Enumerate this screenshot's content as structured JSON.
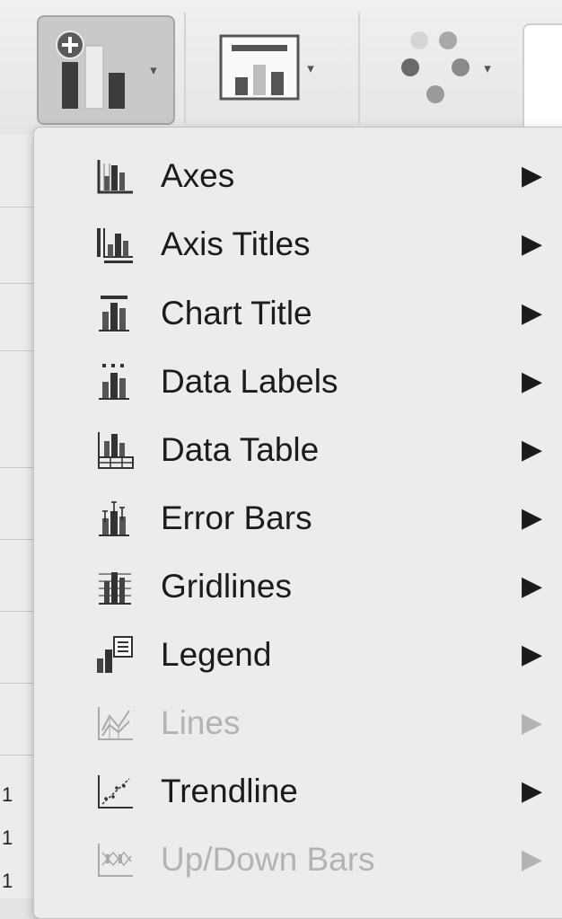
{
  "toolbar": {
    "buttons": [
      {
        "name": "add-chart-element",
        "icon": "add-chart-element-icon",
        "active": true
      },
      {
        "name": "quick-layout",
        "icon": "quick-layout-icon",
        "active": false
      },
      {
        "name": "change-colors",
        "icon": "change-colors-icon",
        "active": false
      }
    ],
    "dropdown_glyph": "▾"
  },
  "sheet": {
    "row_labels": [
      "1",
      "1",
      "1"
    ]
  },
  "menu": {
    "items": [
      {
        "label": "Axes",
        "icon": "axes-icon",
        "submenu_glyph": "▶",
        "enabled": true
      },
      {
        "label": "Axis Titles",
        "icon": "axis-titles-icon",
        "submenu_glyph": "▶",
        "enabled": true
      },
      {
        "label": "Chart Title",
        "icon": "chart-title-icon",
        "submenu_glyph": "▶",
        "enabled": true
      },
      {
        "label": "Data Labels",
        "icon": "data-labels-icon",
        "submenu_glyph": "▶",
        "enabled": true
      },
      {
        "label": "Data Table",
        "icon": "data-table-icon",
        "submenu_glyph": "▶",
        "enabled": true
      },
      {
        "label": "Error Bars",
        "icon": "error-bars-icon",
        "submenu_glyph": "▶",
        "enabled": true
      },
      {
        "label": "Gridlines",
        "icon": "gridlines-icon",
        "submenu_glyph": "▶",
        "enabled": true
      },
      {
        "label": "Legend",
        "icon": "legend-icon",
        "submenu_glyph": "▶",
        "enabled": true
      },
      {
        "label": "Lines",
        "icon": "lines-icon",
        "submenu_glyph": "▶",
        "enabled": false
      },
      {
        "label": "Trendline",
        "icon": "trendline-icon",
        "submenu_glyph": "▶",
        "enabled": true
      },
      {
        "label": "Up/Down Bars",
        "icon": "up-down-bars-icon",
        "submenu_glyph": "▶",
        "enabled": false
      }
    ]
  },
  "colors": {
    "menu_text": "#1b1b1b",
    "disabled_text": "#b3b3b3",
    "menu_background": "#ececec",
    "active_button": "#c9c9c9"
  }
}
